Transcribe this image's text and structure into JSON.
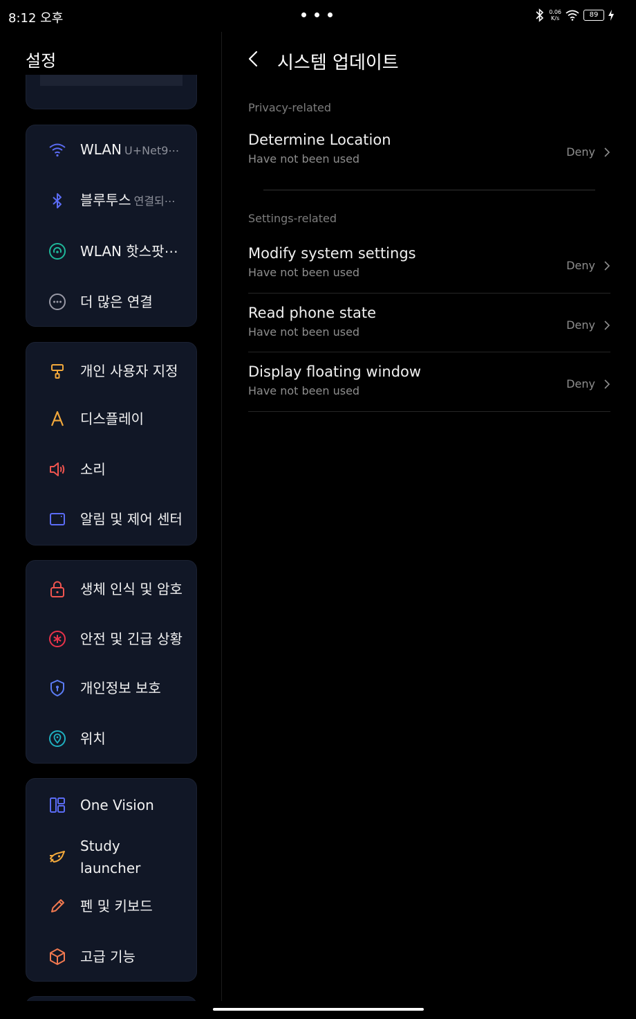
{
  "status_bar": {
    "time": "8:12 오후",
    "net_speed_value": "0.06",
    "net_speed_unit": "K/s",
    "battery": "89",
    "icons": [
      "bluetooth-icon",
      "wifi-icon",
      "battery-icon",
      "charging-icon"
    ]
  },
  "sidebar": {
    "title": "설정",
    "groups": [
      {
        "items": [
          {
            "label": "WLAN",
            "sub": "U+Net9⋯",
            "icon": "wifi-icon",
            "color": "#5b6cf5"
          },
          {
            "label": "블루투스",
            "sub": "연결되⋯",
            "icon": "bluetooth-icon",
            "color": "#5b6cf5"
          },
          {
            "label": "WLAN 핫스팟⋯",
            "icon": "hotspot-icon",
            "color": "#1fb89a"
          },
          {
            "label": "더 많은 연결",
            "icon": "more-icon",
            "color": "#9a9aa6"
          }
        ]
      },
      {
        "items": [
          {
            "label": "개인 사용자 지정",
            "icon": "paint-roller-icon",
            "color": "#f2a83b"
          },
          {
            "label": "디스플레이",
            "icon": "display-icon",
            "color": "#f2a83b"
          },
          {
            "label": "소리",
            "icon": "speaker-icon",
            "color": "#f0544f"
          },
          {
            "label": "알림 및 제어 센터",
            "icon": "notification-icon",
            "color": "#5b6cf5"
          }
        ]
      },
      {
        "items": [
          {
            "label": "생체 인식 및 암호",
            "icon": "lock-icon",
            "color": "#f0544f"
          },
          {
            "label": "안전 및 긴급 상황",
            "icon": "emergency-icon",
            "color": "#e8334a"
          },
          {
            "label": "개인정보 보호",
            "icon": "shield-icon",
            "color": "#5b7cf5"
          },
          {
            "label": "위치",
            "icon": "location-icon",
            "color": "#1fb0c0"
          }
        ]
      },
      {
        "items": [
          {
            "label": "One Vision",
            "icon": "grid-icon",
            "color": "#5b6cf5"
          },
          {
            "label": "Study launcher",
            "icon": "rocket-icon",
            "color": "#f2a83b"
          },
          {
            "label": "펜 및 키보드",
            "icon": "pen-icon",
            "color": "#f0784f"
          },
          {
            "label": "고급 기능",
            "icon": "cube-icon",
            "color": "#f0784f"
          }
        ]
      }
    ]
  },
  "detail": {
    "title": "시스템 업데이트",
    "sections": [
      {
        "header": "Privacy-related",
        "items": [
          {
            "title": "Determine Location",
            "subtitle": "Have not been used",
            "value": "Deny"
          }
        ]
      },
      {
        "header": "Settings-related",
        "items": [
          {
            "title": "Modify system settings",
            "subtitle": "Have not been used",
            "value": "Deny"
          },
          {
            "title": "Read phone state",
            "subtitle": "Have not been used",
            "value": "Deny"
          },
          {
            "title": "Display floating window",
            "subtitle": "Have not been used",
            "value": "Deny"
          }
        ]
      }
    ]
  }
}
